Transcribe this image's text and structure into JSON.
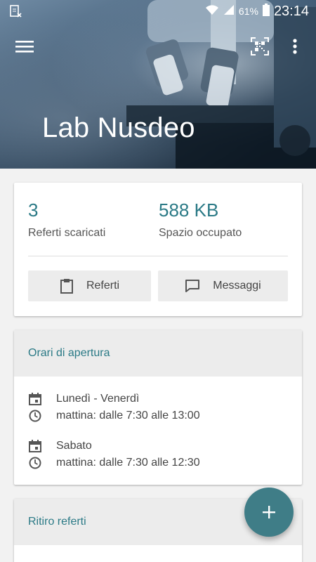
{
  "status_bar": {
    "battery_percent": "61%",
    "time": "23:14"
  },
  "header": {
    "title": "Lab Nusdeo",
    "menu_icon": "hamburger-menu-icon",
    "qr_icon": "qr-code-icon",
    "more_icon": "more-vert-icon"
  },
  "stats": {
    "downloaded_count": "3",
    "downloaded_label": "Referti scaricati",
    "space_value": "588 KB",
    "space_label": "Spazio occupato"
  },
  "actions": {
    "referti_label": "Referti",
    "messaggi_label": "Messaggi"
  },
  "opening_hours": {
    "title": "Orari di apertura",
    "entries": [
      {
        "days": "Lunedì - Venerdì",
        "hours": "mattina: dalle 7:30 alle 13:00"
      },
      {
        "days": "Sabato",
        "hours": "mattina: dalle 7:30 alle 12:30"
      }
    ]
  },
  "pickup": {
    "title": "Ritiro referti"
  },
  "colors": {
    "accent": "#2b7a86",
    "fab": "#3f7d87"
  }
}
